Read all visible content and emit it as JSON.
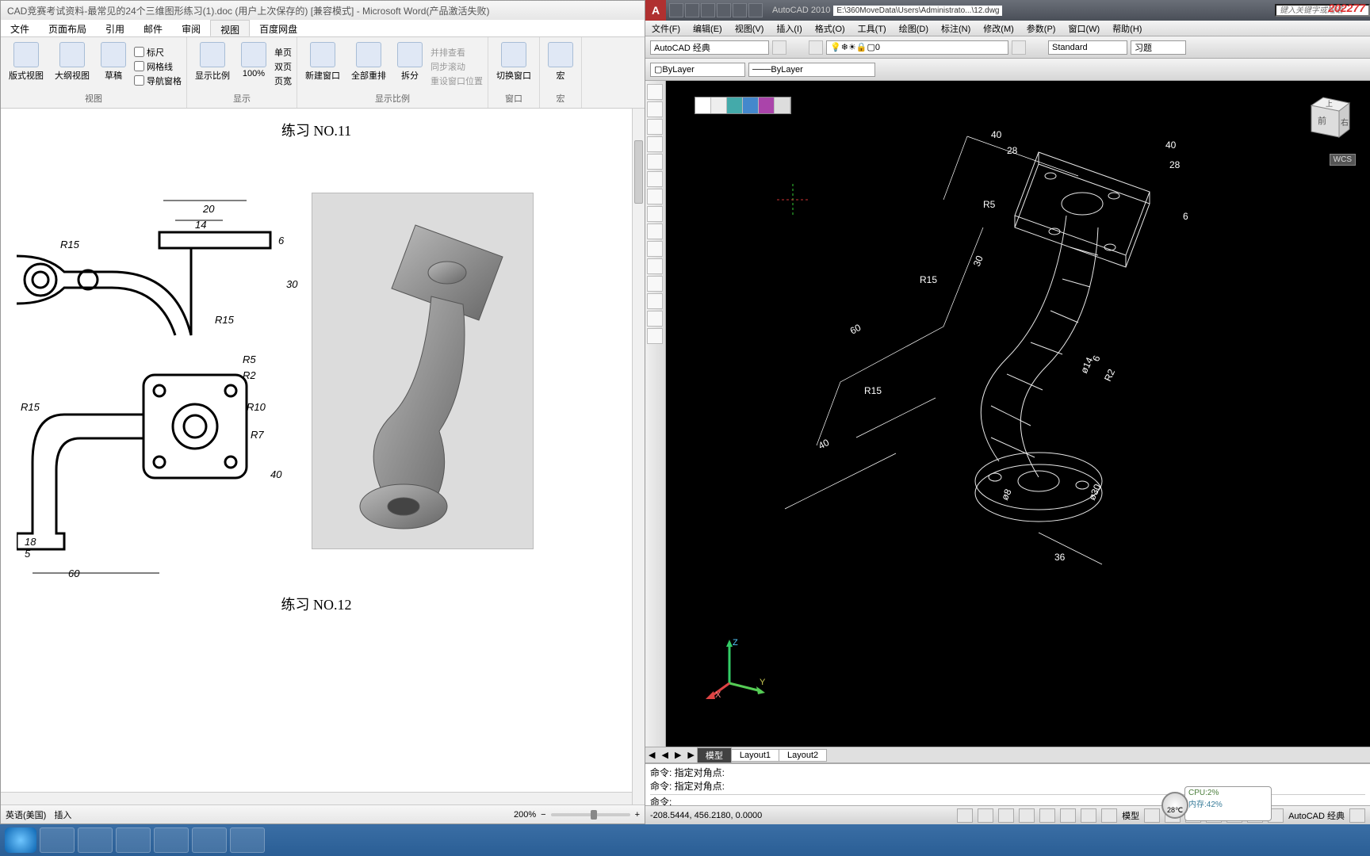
{
  "word": {
    "title": "CAD竞赛考试资料-最常见的24个三维图形练习(1).doc (用户上次保存的) [兼容模式] - Microsoft Word(产品激活失败)",
    "tabs": [
      "文件",
      "页面布局",
      "引用",
      "邮件",
      "审阅",
      "视图",
      "百度网盘"
    ],
    "activeTab": "视图",
    "ribbon": {
      "groups": [
        {
          "label": "视图",
          "buttons": [
            "版式视图",
            "大纲视图",
            "草稿"
          ],
          "checks": [
            "标尺",
            "网格线",
            "导航窗格"
          ]
        },
        {
          "label": "显示",
          "buttons": [
            "显示比例",
            "100%"
          ],
          "extras": [
            "单页",
            "双页",
            "页宽"
          ]
        },
        {
          "label": "显示比例",
          "buttons": [
            "新建窗口",
            "全部重排",
            "拆分"
          ],
          "extras": [
            "并排查看",
            "同步滚动",
            "重设窗口位置"
          ]
        },
        {
          "label": "窗口",
          "buttons": [
            "切换窗口"
          ]
        },
        {
          "label": "宏",
          "buttons": [
            "宏"
          ]
        }
      ]
    },
    "doc": {
      "title1": "练习 NO.11",
      "title2": "练习 NO.12"
    },
    "chart_data": {
      "type": "technical-drawing",
      "dimensions_top_view": {
        "20": 20,
        "14": 14,
        "6": 6,
        "30": 30,
        "R15_1": "R15",
        "R15_2": "R15"
      },
      "dimensions_front_view": {
        "R5": "R5",
        "R2": "R2",
        "R10": "R10",
        "R7": "R7",
        "R15": "R15",
        "18": 18,
        "5": 5,
        "60": 60,
        "40": 40
      }
    },
    "status": {
      "lang": "英语(美国)",
      "mode": "插入",
      "zoom": "200%"
    }
  },
  "autocad": {
    "app": "AutoCAD 2010",
    "path": "E:\\360MoveData\\Users\\Administrato...\\12.dwg",
    "search_ph": "键入关键字或短语",
    "menus": [
      "文件(F)",
      "编辑(E)",
      "视图(V)",
      "插入(I)",
      "格式(O)",
      "工具(T)",
      "绘图(D)",
      "标注(N)",
      "修改(M)",
      "参数(P)",
      "窗口(W)",
      "帮助(H)"
    ],
    "workspace": "AutoCAD 经典",
    "layer": "0",
    "style": "Standard",
    "annot": "习题",
    "linelayer": "ByLayer",
    "lineweight": "ByLayer",
    "toolline2": {
      "bylayer": "ByLayer"
    },
    "viewcube": {
      "front": "前",
      "right": "右",
      "top": "上"
    },
    "wcs": "WCS",
    "dims": {
      "d40a": "40",
      "d28a": "28",
      "d40b": "40",
      "d28b": "28",
      "R5": "R5",
      "d6": "6",
      "d30": "30",
      "R15a": "R15",
      "d60": "60",
      "R15b": "R15",
      "d40c": "40",
      "R2": "R2",
      "phi14": "ø14",
      "phi30": "ø30",
      "phi8": "ø8",
      "d36": "36",
      "d6b": "6"
    },
    "ucs": {
      "x": "X",
      "y": "Y",
      "z": "Z"
    },
    "tabs": {
      "model": "模型",
      "l1": "Layout1",
      "l2": "Layout2"
    },
    "cmd": {
      "l1": "命令: 指定对角点:",
      "l2": "命令: 指定对角点:",
      "prompt": "命令:"
    },
    "coords": "-208.5444, 456.2180, 0.0000",
    "status_right": {
      "model": "模型",
      "ws": "AutoCAD 经典"
    }
  },
  "sysmon": {
    "cpu": "CPU:2%",
    "mem": "内存:42%",
    "temp": "28℃"
  },
  "watermark": "202277"
}
